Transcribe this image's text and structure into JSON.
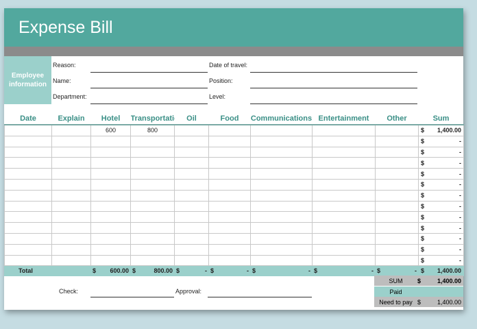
{
  "title": "Expense Bill",
  "employee_label": "Employee information",
  "fields": {
    "reason": "Reason:",
    "name": "Name:",
    "department": "Department:",
    "date_of_travel": "Date of travel:",
    "position": "Position:",
    "level": "Level:"
  },
  "columns": [
    "Date",
    "Explain",
    "Hotel",
    "Transportatio",
    "Oil",
    "Food",
    "Communications",
    "Entertainment",
    "Other",
    "Sum"
  ],
  "rows": [
    {
      "hotel": "600",
      "transport": "800",
      "sum": "1,400.00"
    },
    {
      "sum": "-"
    },
    {
      "sum": "-"
    },
    {
      "sum": "-"
    },
    {
      "sum": "-"
    },
    {
      "sum": "-"
    },
    {
      "sum": "-"
    },
    {
      "sum": "-"
    },
    {
      "sum": "-"
    },
    {
      "sum": "-"
    },
    {
      "sum": "-"
    },
    {
      "sum": "-"
    },
    {
      "sum": "-"
    }
  ],
  "currency": "$",
  "total": {
    "label": "Total",
    "hotel": "600.00",
    "transport": "800.00",
    "oil": "-",
    "food": "-",
    "communications": "-",
    "entertainment": "-",
    "other": "-",
    "sum": "1,400.00"
  },
  "summary": {
    "sum_label": "SUM",
    "sum_value": "1,400.00",
    "paid_label": "Paid",
    "need_label": "Need to pay",
    "need_value": "1,400.00"
  },
  "footer": {
    "check": "Check:",
    "approval": "Approval:"
  }
}
